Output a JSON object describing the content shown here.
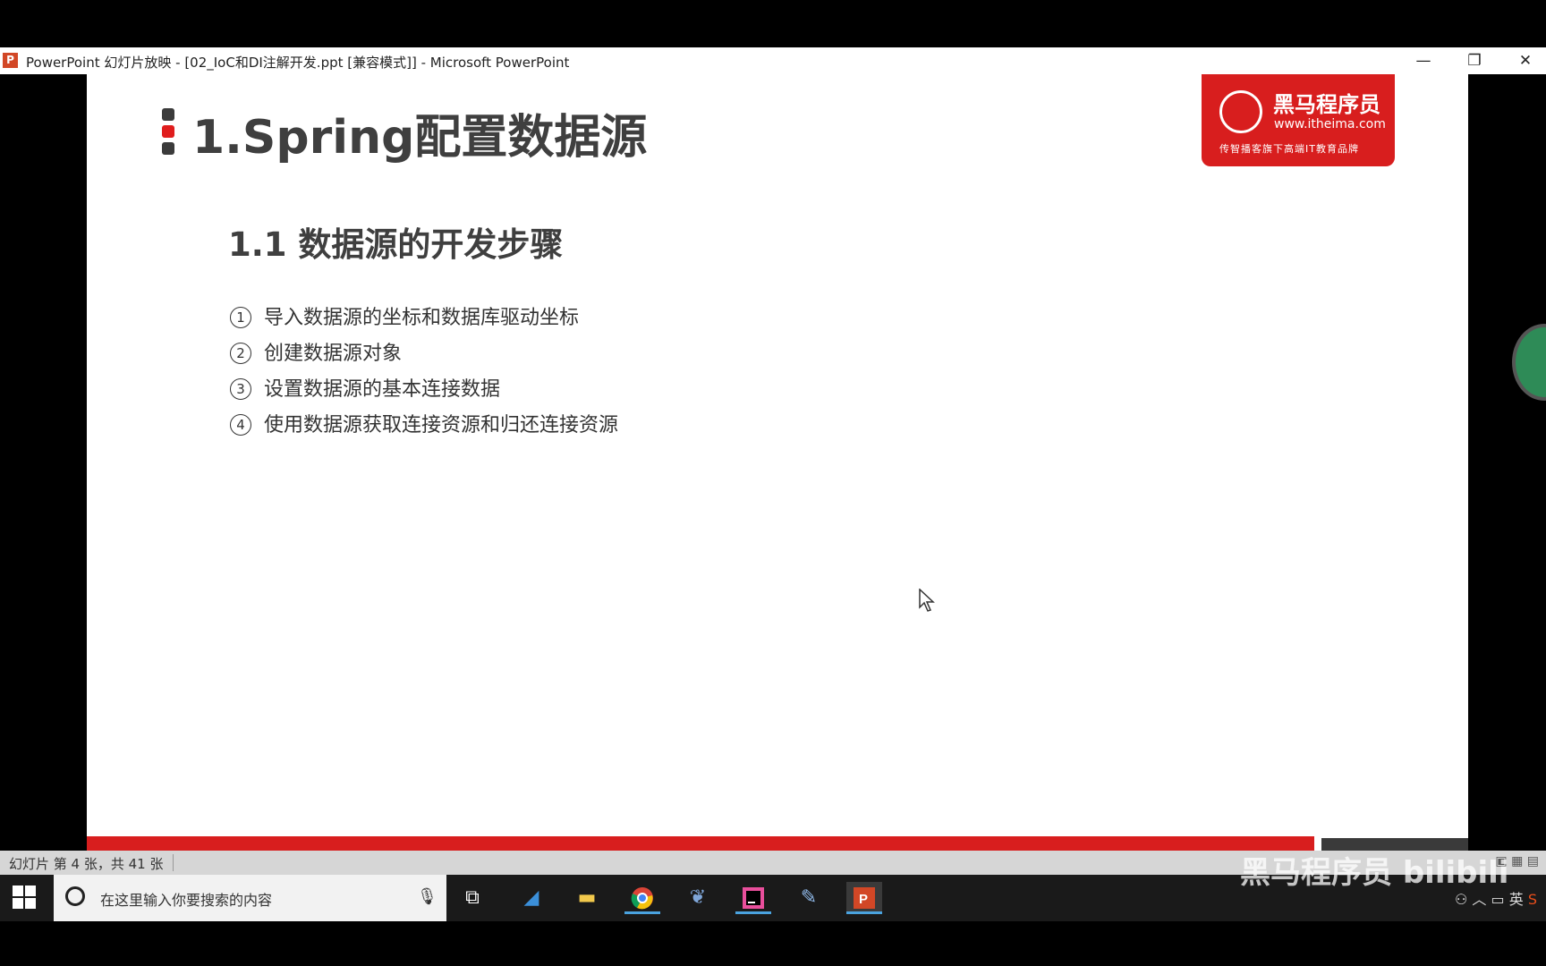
{
  "window": {
    "app_icon": "P",
    "title": "PowerPoint 幻灯片放映 - [02_IoC和DI注解开发.ppt [兼容模式]] - Microsoft PowerPoint",
    "controls": {
      "minimize": "—",
      "restore": "❐",
      "close": "✕"
    }
  },
  "slide": {
    "title": "1.Spring配置数据源",
    "subtitle": "1.1 数据源的开发步骤",
    "steps": [
      {
        "num": "1",
        "text": "导入数据源的坐标和数据库驱动坐标"
      },
      {
        "num": "2",
        "text": "创建数据源对象"
      },
      {
        "num": "3",
        "text": "设置数据源的基本连接数据"
      },
      {
        "num": "4",
        "text": "使用数据源获取连接资源和归还连接资源"
      }
    ],
    "logo": {
      "name": "黑马程序员",
      "url": "www.itheima.com",
      "slogan": "传智播客旗下高端IT教育品牌"
    },
    "accent_color": "#d81e1e"
  },
  "statusbar": {
    "slide_info": "幻灯片 第 4 张，共 41 张"
  },
  "taskbar": {
    "search_placeholder": "在这里输入你要搜索的内容",
    "apps": [
      "task-view",
      "app-blue",
      "file-explorer",
      "chrome",
      "app-dolphin",
      "intellij-idea",
      "app-paint",
      "powerpoint"
    ],
    "tray": {
      "ime": "英"
    }
  },
  "overlay": {
    "watermark": "黑马程序员 bilibili"
  }
}
